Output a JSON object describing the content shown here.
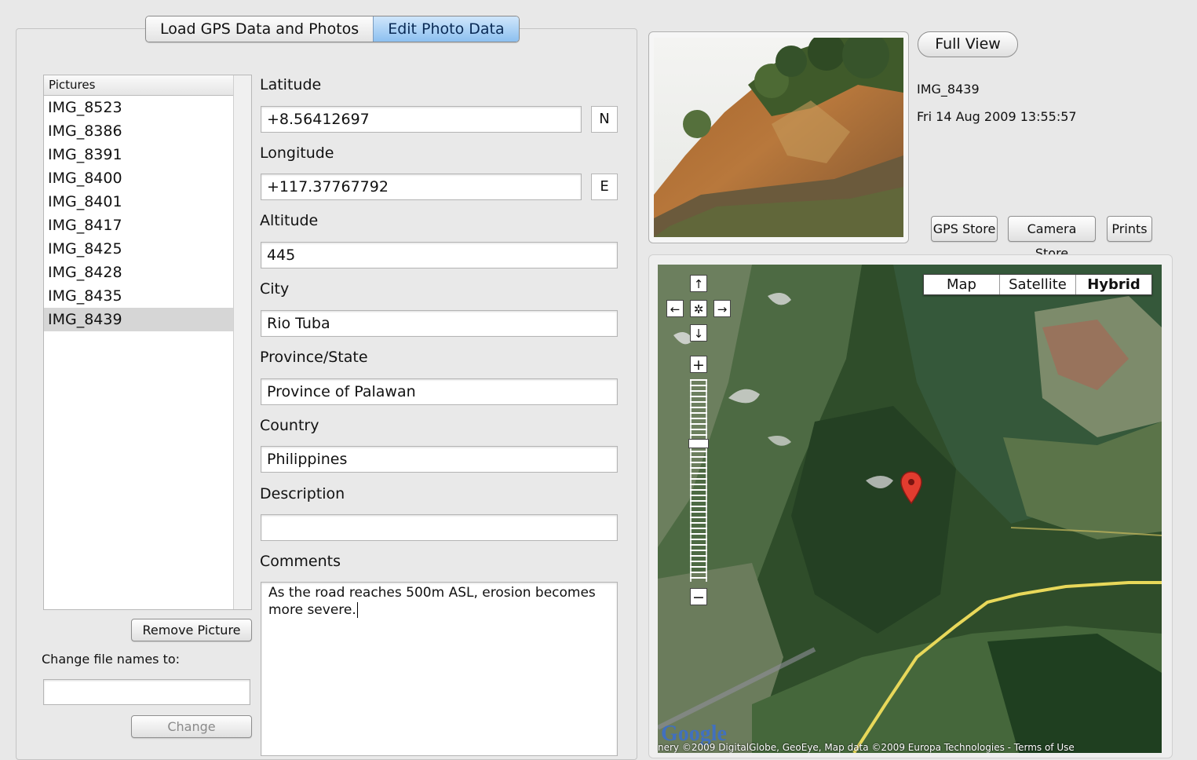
{
  "tabs": [
    "Load GPS Data and Photos",
    "Edit Photo Data"
  ],
  "pictures": {
    "header": "Pictures",
    "items": [
      "IMG_8523",
      "IMG_8386",
      "IMG_8391",
      "IMG_8400",
      "IMG_8401",
      "IMG_8417",
      "IMG_8425",
      "IMG_8428",
      "IMG_8435",
      "IMG_8439"
    ],
    "selected": "IMG_8439"
  },
  "left_controls": {
    "remove_label": "Remove Picture",
    "rename_label": "Change file names to:",
    "rename_value": "",
    "change_label": "Change"
  },
  "form": {
    "latitude_label": "Latitude",
    "latitude_value": "+8.56412697",
    "latitude_dir": "N",
    "longitude_label": "Longitude",
    "longitude_value": "+117.37767792",
    "longitude_dir": "E",
    "altitude_label": "Altitude",
    "altitude_value": "445",
    "city_label": "City",
    "city_value": "Rio Tuba",
    "province_label": "Province/State",
    "province_value": "Province of Palawan",
    "country_label": "Country",
    "country_value": "Philippines",
    "description_label": "Description",
    "description_value": "",
    "comments_label": "Comments",
    "comments_value": "As the road reaches 500m ASL, erosion becomes more severe."
  },
  "photo": {
    "full_view_label": "Full View",
    "name": "IMG_8439",
    "date": "Fri 14 Aug 2009 13:55:57",
    "buttons": [
      "GPS Store",
      "Camera Store",
      "Prints"
    ]
  },
  "map": {
    "types": [
      "Map",
      "Satellite",
      "Hybrid"
    ],
    "active_type": "Hybrid",
    "google_logo": "Google",
    "attribution": "nery ©2009 DigitalGlobe, GeoEye, Map data ©2009 Europa Technologies - Terms of Use",
    "pan_icons": [
      "arrow-up-icon",
      "arrow-left-icon",
      "center-icon",
      "arrow-right-icon",
      "arrow-down-icon"
    ],
    "colors": {
      "marker": "#e23c2f",
      "road": "#e8d85a"
    }
  }
}
